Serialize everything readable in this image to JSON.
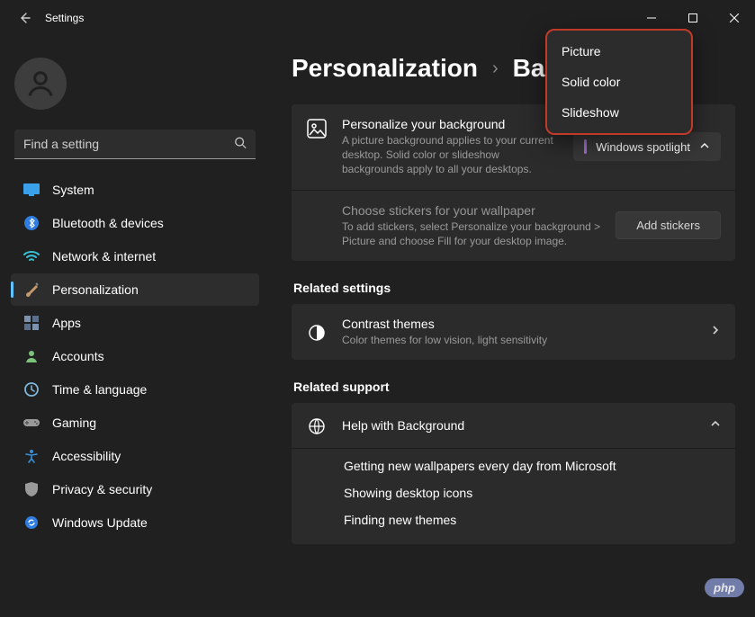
{
  "window": {
    "title": "Settings"
  },
  "search": {
    "placeholder": "Find a setting"
  },
  "nav": {
    "items": [
      {
        "label": "System"
      },
      {
        "label": "Bluetooth & devices"
      },
      {
        "label": "Network & internet"
      },
      {
        "label": "Personalization"
      },
      {
        "label": "Apps"
      },
      {
        "label": "Accounts"
      },
      {
        "label": "Time & language"
      },
      {
        "label": "Gaming"
      },
      {
        "label": "Accessibility"
      },
      {
        "label": "Privacy & security"
      },
      {
        "label": "Windows Update"
      }
    ]
  },
  "breadcrumb": {
    "parent": "Personalization",
    "sep": "›",
    "current": "Background"
  },
  "bg_card": {
    "row1_title": "Personalize your background",
    "row1_sub": "A picture background applies to your current desktop. Solid color or slideshow backgrounds apply to all your desktops.",
    "row2_title": "Choose stickers for your wallpaper",
    "row2_sub": "To add stickers, select Personalize your background > Picture and choose Fill for your desktop image.",
    "add_stickers": "Add stickers",
    "selected": "Windows spotlight"
  },
  "dropdown": {
    "opt1": "Picture",
    "opt2": "Solid color",
    "opt3": "Slideshow"
  },
  "related": {
    "heading": "Related settings",
    "contrast_title": "Contrast themes",
    "contrast_sub": "Color themes for low vision, light sensitivity"
  },
  "support": {
    "heading": "Related support",
    "help_title": "Help with Background",
    "links": {
      "a": "Getting new wallpapers every day from Microsoft",
      "b": "Showing desktop icons",
      "c": "Finding new themes"
    }
  },
  "watermark": {
    "pill": "php",
    "txt": ""
  }
}
